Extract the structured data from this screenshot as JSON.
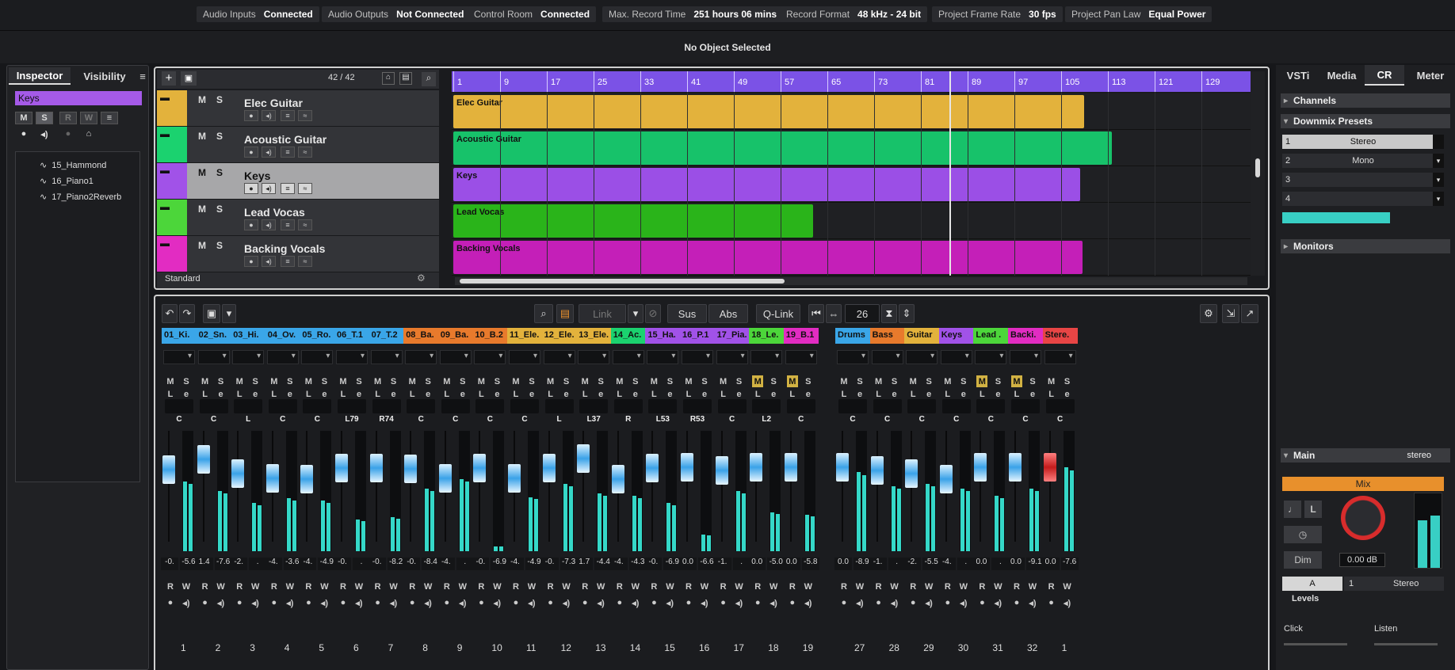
{
  "status_bar": [
    {
      "key": "Audio Inputs",
      "value": "Connected"
    },
    {
      "key": "Audio Outputs",
      "value": "Not Connected"
    },
    {
      "key": "Control Room",
      "value": "Connected"
    },
    {
      "key": "Max. Record Time",
      "value": "251 hours 06 mins"
    },
    {
      "key": "Record Format",
      "value": "48 kHz - 24 bit"
    },
    {
      "key": "Project Frame Rate",
      "value": "30 fps"
    },
    {
      "key": "Project Pan Law",
      "value": "Equal Power"
    }
  ],
  "info_line": "No Object Selected",
  "left_zone": {
    "tabs": [
      "Inspector",
      "Visibility"
    ],
    "track_name": "Keys",
    "buttons": [
      "M",
      "S",
      "R",
      "W"
    ],
    "child_tracks": [
      "15_Hammond",
      "16_Piano1",
      "17_Piano2Reverb"
    ]
  },
  "project": {
    "track_count": "42 / 42",
    "preset": "Standard",
    "ruler_ticks": [
      "1",
      "9",
      "17",
      "25",
      "33",
      "41",
      "49",
      "57",
      "65",
      "73",
      "81",
      "89",
      "97",
      "105",
      "113",
      "121",
      "129"
    ],
    "tracks": [
      {
        "name": "Elec Guitar",
        "color": "#e3b23c",
        "selected": false
      },
      {
        "name": "Acoustic Guitar",
        "color": "#1bd26f",
        "selected": false
      },
      {
        "name": "Keys",
        "color": "#a152e8",
        "selected": true
      },
      {
        "name": "Lead Vocas",
        "color": "#4cd63a",
        "selected": false
      },
      {
        "name": "Backing Vocals",
        "color": "#e22cc2",
        "selected": false
      }
    ],
    "clips": [
      {
        "label": "Elec Guitar",
        "color": "#e3b23c",
        "end": 0.78
      },
      {
        "label": "Acoustic Guitar",
        "color": "#17c26a",
        "end": 0.815
      },
      {
        "label": "Keys",
        "color": "#9b4fe6",
        "end": 0.775
      },
      {
        "label": "Lead Vocas",
        "color": "#2ab41a",
        "end": 0.445
      },
      {
        "label": "Backing Vocals",
        "color": "#c41fb8",
        "end": 0.778
      }
    ]
  },
  "mixer": {
    "toolbar": {
      "link": "Link",
      "sus": "Sus",
      "abs": "Abs",
      "qlink": "Q-Link",
      "value": "26"
    },
    "channels": [
      {
        "label": "01_Ki.",
        "color": "#3aa6e8",
        "pan": "C",
        "v1": "-0.",
        "v2": "-5.6",
        "num": "1",
        "fader": 0.74,
        "meter": 0.58,
        "mute": false
      },
      {
        "label": "02_Sn.",
        "color": "#3aa6e8",
        "pan": "C",
        "v1": "1.4",
        "v2": "-7.6",
        "num": "2",
        "fader": 0.85,
        "meter": 0.5,
        "mute": false
      },
      {
        "label": "03_Hi.",
        "color": "#3aa6e8",
        "pan": "L",
        "v1": "-2.",
        "v2": ".",
        "num": "3",
        "fader": 0.7,
        "meter": 0.4,
        "mute": false
      },
      {
        "label": "04_Ov.",
        "color": "#3aa6e8",
        "pan": "C",
        "v1": "-4.",
        "v2": "-3.6",
        "num": "4",
        "fader": 0.65,
        "meter": 0.44,
        "mute": false
      },
      {
        "label": "05_Ro.",
        "color": "#3aa6e8",
        "pan": "C",
        "v1": "-4.",
        "v2": "-4.9",
        "num": "5",
        "fader": 0.64,
        "meter": 0.42,
        "mute": false
      },
      {
        "label": "06_T.1",
        "color": "#3aa6e8",
        "pan": "L79",
        "v1": "-0.",
        "v2": ".",
        "num": "6",
        "fader": 0.76,
        "meter": 0.26,
        "mute": false
      },
      {
        "label": "07_T.2",
        "color": "#3aa6e8",
        "pan": "R74",
        "v1": "-0.",
        "v2": "-8.2",
        "num": "7",
        "fader": 0.76,
        "meter": 0.28,
        "mute": false
      },
      {
        "label": "08_Ba.",
        "color": "#e87a2c",
        "pan": "C",
        "v1": "-0.",
        "v2": "-8.4",
        "num": "8",
        "fader": 0.75,
        "meter": 0.52,
        "mute": false
      },
      {
        "label": "09_Ba.",
        "color": "#e87a2c",
        "pan": "C",
        "v1": "-4.",
        "v2": ".",
        "num": "9",
        "fader": 0.65,
        "meter": 0.6,
        "mute": false
      },
      {
        "label": "10_B.2",
        "color": "#e87a2c",
        "pan": "C",
        "v1": "-0.",
        "v2": "-6.9",
        "num": "10",
        "fader": 0.76,
        "meter": 0.04,
        "mute": false
      },
      {
        "label": "11_Ele.",
        "color": "#e3b23c",
        "pan": "C",
        "v1": "-4.",
        "v2": "-4.9",
        "num": "11",
        "fader": 0.65,
        "meter": 0.45,
        "mute": false
      },
      {
        "label": "12_Ele.",
        "color": "#e3b23c",
        "pan": "L",
        "v1": "-0.",
        "v2": "-7.3",
        "num": "12",
        "fader": 0.76,
        "meter": 0.56,
        "mute": false
      },
      {
        "label": "13_Ele.",
        "color": "#e3b23c",
        "pan": "L37",
        "v1": "1.7",
        "v2": "-4.4",
        "num": "13",
        "fader": 0.86,
        "meter": 0.48,
        "mute": false
      },
      {
        "label": "14_Ac.",
        "color": "#1bd26f",
        "pan": "R",
        "v1": "-4.",
        "v2": "-4.3",
        "num": "14",
        "fader": 0.64,
        "meter": 0.46,
        "mute": false
      },
      {
        "label": "15_Ha.",
        "color": "#a152e8",
        "pan": "L53",
        "v1": "-0.",
        "v2": "-6.9",
        "num": "15",
        "fader": 0.76,
        "meter": 0.4,
        "mute": false
      },
      {
        "label": "16_P.1",
        "color": "#a152e8",
        "pan": "R53",
        "v1": "0.0",
        "v2": "-6.6",
        "num": "16",
        "fader": 0.77,
        "meter": 0.14,
        "mute": false
      },
      {
        "label": "17_Pia.",
        "color": "#a152e8",
        "pan": "C",
        "v1": "-1.",
        "v2": ".",
        "num": "17",
        "fader": 0.73,
        "meter": 0.5,
        "mute": false
      },
      {
        "label": "18_Le.",
        "color": "#4cd63a",
        "pan": "L2",
        "v1": "0.0",
        "v2": "-5.0",
        "num": "18",
        "fader": 0.77,
        "meter": 0.32,
        "mute": true
      },
      {
        "label": "19_B.1",
        "color": "#e22cc2",
        "pan": "C",
        "v1": "0.0",
        "v2": "-5.8",
        "num": "19",
        "fader": 0.77,
        "meter": 0.3,
        "mute": true
      }
    ],
    "groups": [
      {
        "label": "Drums",
        "color": "#3aa6e8",
        "pan": "C",
        "v1": "0.0",
        "v2": "-8.9",
        "num": "27",
        "fader": 0.77,
        "meter": 0.66,
        "mute": false
      },
      {
        "label": "Bass",
        "color": "#e87a2c",
        "pan": "C",
        "v1": "-1.",
        "v2": ".",
        "num": "28",
        "fader": 0.73,
        "meter": 0.54,
        "mute": false
      },
      {
        "label": "Guitar",
        "color": "#e3b23c",
        "pan": "C",
        "v1": "-2.",
        "v2": "-5.5",
        "num": "29",
        "fader": 0.7,
        "meter": 0.56,
        "mute": false
      },
      {
        "label": "Keys",
        "color": "#a152e8",
        "pan": "C",
        "v1": "-4.",
        "v2": ".",
        "num": "30",
        "fader": 0.64,
        "meter": 0.52,
        "mute": false
      },
      {
        "label": "Lead .",
        "color": "#4cd63a",
        "pan": "C",
        "v1": "0.0",
        "v2": ".",
        "num": "31",
        "fader": 0.77,
        "meter": 0.46,
        "mute": true
      },
      {
        "label": "Backi.",
        "color": "#e22cc2",
        "pan": "C",
        "v1": "0.0",
        "v2": "-9.1",
        "num": "32",
        "fader": 0.77,
        "meter": 0.52,
        "mute": true
      },
      {
        "label": "Stere.",
        "color": "#e84545",
        "pan": "C",
        "v1": "0.0",
        "v2": "-7.6",
        "num": "1",
        "fader": 0.77,
        "meter": 0.7,
        "mute": false,
        "red": true
      }
    ]
  },
  "right_zone": {
    "tabs": [
      "VSTi",
      "Media",
      "CR",
      "Meter"
    ],
    "channels": "Channels",
    "downmix": "Downmix Presets",
    "presets": [
      {
        "i": "1",
        "v": "Stereo"
      },
      {
        "i": "2",
        "v": "Mono"
      },
      {
        "i": "3",
        "v": ""
      },
      {
        "i": "4",
        "v": ""
      }
    ],
    "monitors": "Monitors",
    "main": "Main",
    "main_mode": "stereo",
    "mix": "Mix",
    "dim": "Dim",
    "level": "0.00 dB",
    "a": "A",
    "one": "1",
    "stereo": "Stereo",
    "levels": "Levels",
    "click": "Click",
    "listen": "Listen"
  }
}
